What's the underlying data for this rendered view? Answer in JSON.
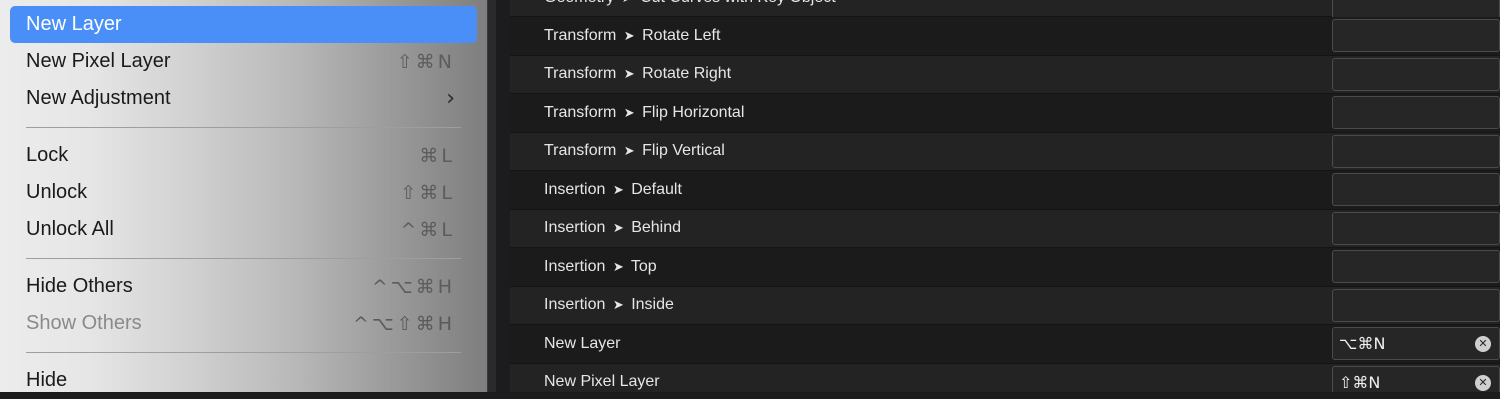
{
  "menu": {
    "items": [
      {
        "label": "New Layer",
        "shortcut": "",
        "highlighted": true
      },
      {
        "label": "New Pixel Layer",
        "shortcut": "⇧⌘N"
      },
      {
        "label": "New Adjustment",
        "submenu": "›"
      },
      {
        "label": "Lock",
        "shortcut": "⌘L"
      },
      {
        "label": "Unlock",
        "shortcut": "⇧⌘L"
      },
      {
        "label": "Unlock All",
        "shortcut": "^⌘L"
      },
      {
        "label": "Hide Others",
        "shortcut": "^⌥⌘H"
      },
      {
        "label": "Show Others",
        "shortcut": "^⌥⇧⌘H",
        "disabled": true
      },
      {
        "label": "Hide"
      }
    ]
  },
  "shortcuts_panel": {
    "rows": [
      {
        "group": "Geometry",
        "name": "Cut Curves with Key Object",
        "shortcut": ""
      },
      {
        "group": "Transform",
        "name": "Rotate Left",
        "shortcut": ""
      },
      {
        "group": "Transform",
        "name": "Rotate Right",
        "shortcut": ""
      },
      {
        "group": "Transform",
        "name": "Flip Horizontal",
        "shortcut": ""
      },
      {
        "group": "Transform",
        "name": "Flip Vertical",
        "shortcut": ""
      },
      {
        "group": "Insertion",
        "name": "Default",
        "shortcut": ""
      },
      {
        "group": "Insertion",
        "name": "Behind",
        "shortcut": ""
      },
      {
        "group": "Insertion",
        "name": "Top",
        "shortcut": ""
      },
      {
        "group": "Insertion",
        "name": "Inside",
        "shortcut": ""
      },
      {
        "group": "",
        "name": "New Layer",
        "shortcut": "⌥⌘N"
      },
      {
        "group": "",
        "name": "New Pixel Layer",
        "shortcut": "⇧⌘N"
      }
    ],
    "arrow": "➤",
    "clear_glyph": "✕"
  }
}
